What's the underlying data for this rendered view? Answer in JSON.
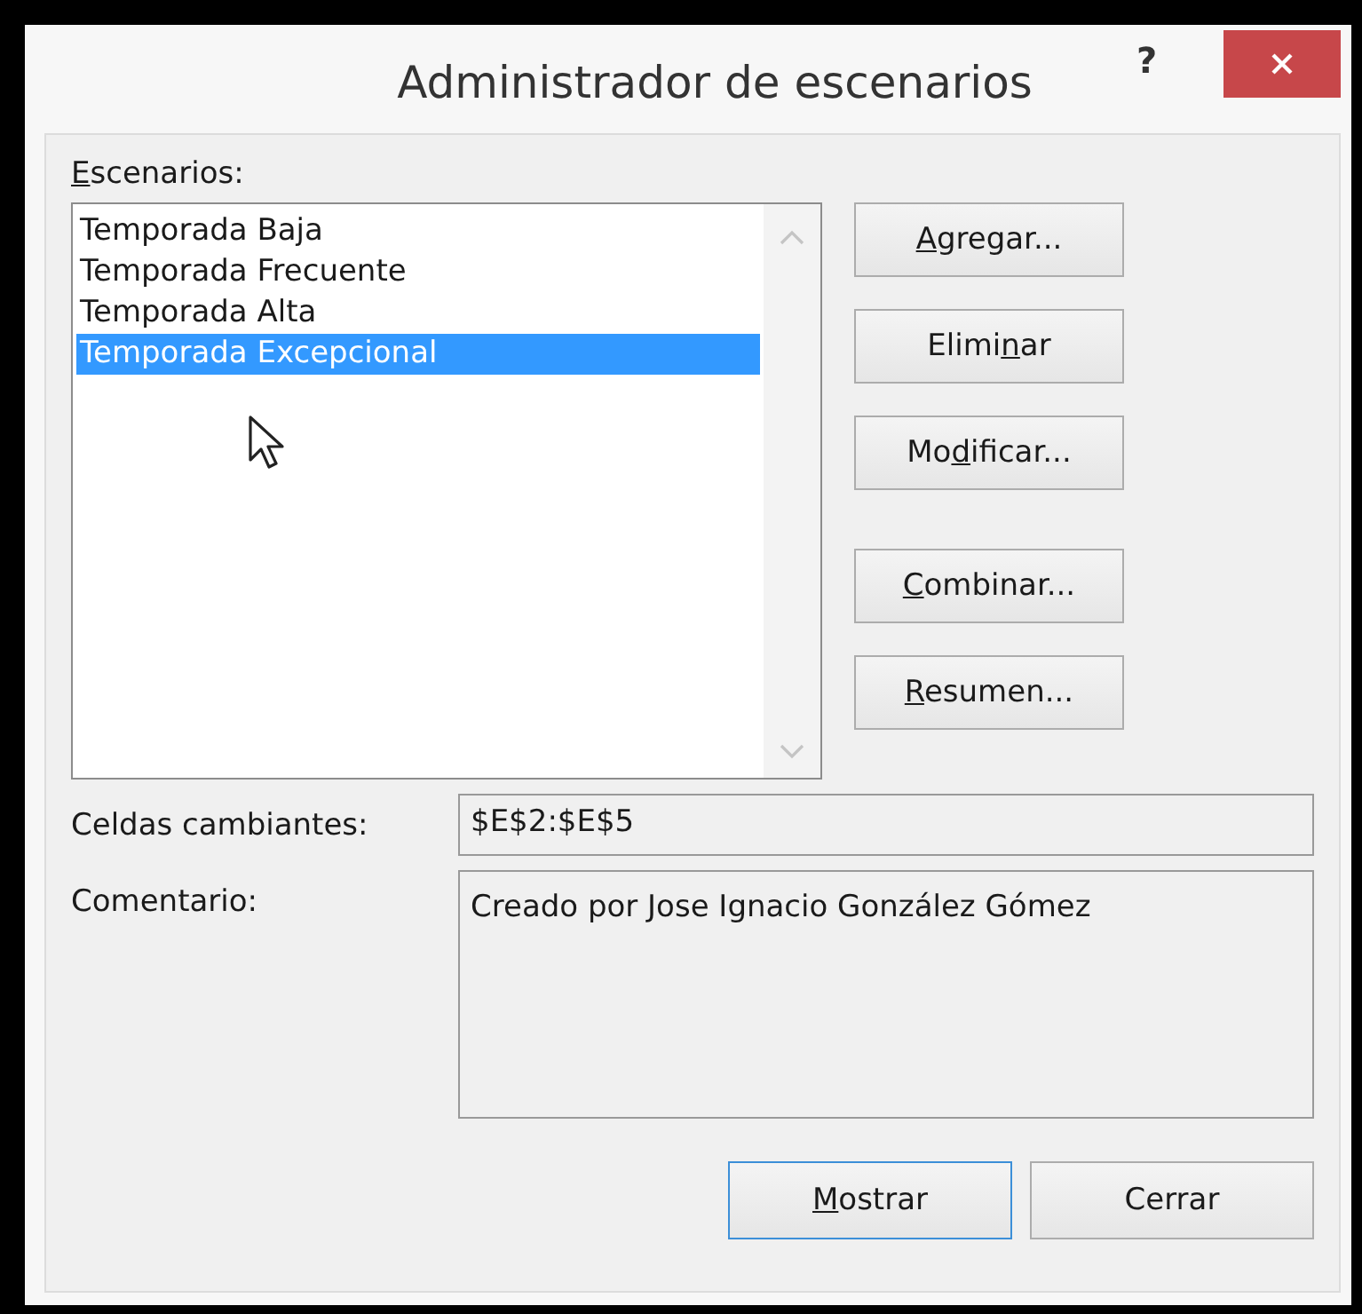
{
  "window": {
    "title": "Administrador de escenarios",
    "help": "?"
  },
  "scenarios_label": {
    "key": "E",
    "end": "scenarios:"
  },
  "scenarios": [
    {
      "label": "Temporada Baja",
      "selected": false
    },
    {
      "label": "Temporada Frecuente",
      "selected": false
    },
    {
      "label": "Temporada Alta",
      "selected": false
    },
    {
      "label": "Temporada Excepcional",
      "selected": true
    }
  ],
  "side_buttons": [
    {
      "key": "A",
      "end": "gregar..."
    },
    {
      "start": "Elimi",
      "key": "n",
      "end": "ar"
    },
    {
      "start": "Mo",
      "key": "d",
      "end": "ificar..."
    },
    {
      "key": "C",
      "end": "ombinar..."
    },
    {
      "key": "R",
      "end": "esumen..."
    }
  ],
  "changing_cells": {
    "label": "Celdas cambiantes:",
    "value": "$E$2:$E$5"
  },
  "comment": {
    "label": "Comentario:",
    "value": "Creado por Jose Ignacio González Gómez"
  },
  "footer_buttons": [
    {
      "key": "M",
      "end": "ostrar",
      "default": true
    },
    {
      "start": "Cerrar",
      "default": false
    }
  ]
}
